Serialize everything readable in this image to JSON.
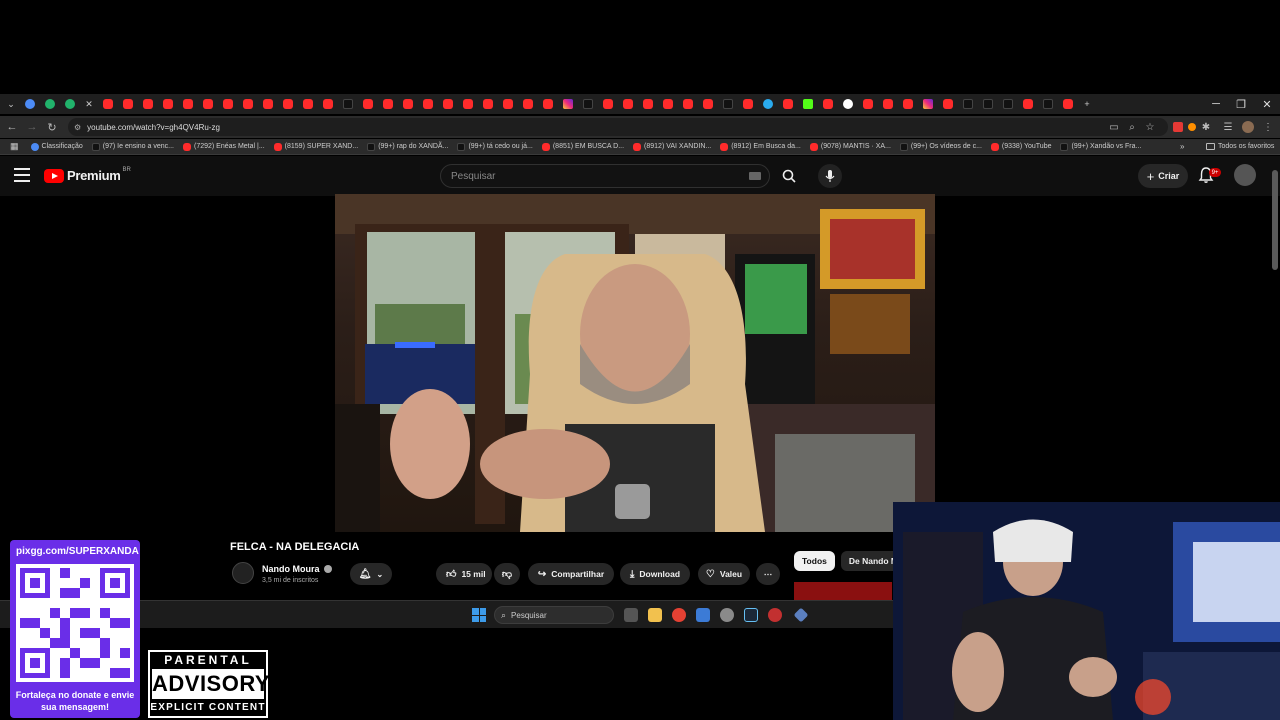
{
  "browser": {
    "url": "youtube.com/watch?v=gh4QV4Ru-zg",
    "bookmarks": [
      {
        "label": "Classificação",
        "icon": "chat-icon"
      },
      {
        "label": "(97) Ie ensino a venc...",
        "icon": "tiktok-icon"
      },
      {
        "label": "(7292) Enéas Metal |...",
        "icon": "youtube-icon"
      },
      {
        "label": "(8159) SUPER XAND...",
        "icon": "youtube-icon"
      },
      {
        "label": "(99+) rap do XANDÃ...",
        "icon": "tiktok-icon"
      },
      {
        "label": "(99+) tá cedo ou já...",
        "icon": "tiktok-icon"
      },
      {
        "label": "(8851) EM BUSCA D...",
        "icon": "youtube-icon"
      },
      {
        "label": "(8912) VAI XANDIN...",
        "icon": "youtube-icon"
      },
      {
        "label": "(8912) Em Busca da...",
        "icon": "youtube-icon"
      },
      {
        "label": "(9078) MANTIS · XA...",
        "icon": "youtube-icon"
      },
      {
        "label": "(99+) Os vídeos de c...",
        "icon": "tiktok-icon"
      },
      {
        "label": "(9338) YouTube",
        "icon": "youtube-icon"
      },
      {
        "label": "(99+) Xandão vs Fra...",
        "icon": "tiktok-icon"
      }
    ],
    "all_favorites": "Todos os favoritos"
  },
  "youtube": {
    "logo_text": "Premium",
    "logo_country": "BR",
    "search_placeholder": "Pesquisar",
    "create_label": "Criar",
    "notification_count": "9+",
    "video": {
      "title": "FELCA - NA DELEGACIA",
      "channel": "Nando Moura",
      "subscribers": "3,5 mi de inscritos",
      "likes": "15 mil",
      "share_label": "Compartilhar",
      "download_label": "Download",
      "thanks_label": "Valeu"
    },
    "chips": [
      "Todos",
      "De Nando M"
    ]
  },
  "taskbar": {
    "search_label": "Pesquisar"
  },
  "overlay": {
    "donate_url": "pixgg.com/SUPERXANDA",
    "donate_caption": "Fortaleça no donate e envie sua mensagem!",
    "advisory_top": "PARENTAL",
    "advisory_mid": "ADVISORY",
    "advisory_bottom": "EXPLICIT CONTENT"
  },
  "colors": {
    "youtube_red": "#ff0000",
    "overlay_purple": "#6a2ee8",
    "background": "#0f0f0f"
  }
}
